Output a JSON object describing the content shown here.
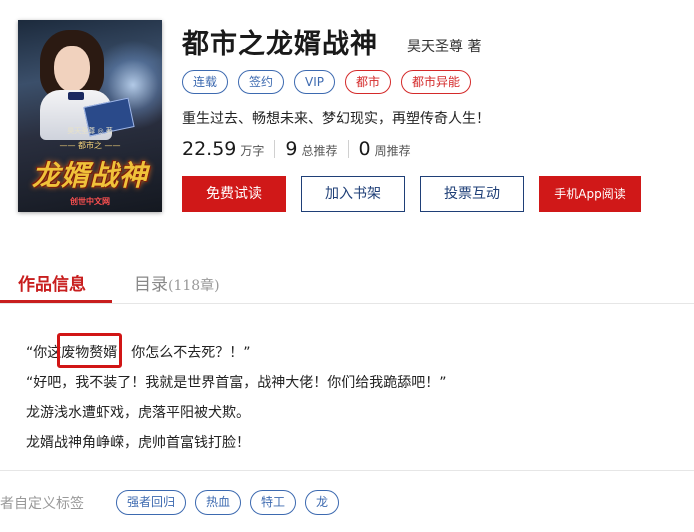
{
  "cover": {
    "author_line": "昊天圣尊 ◎ 著",
    "sub_title": "—— 都市之 ——",
    "big_title": "龙婿战神",
    "publisher": "创世中文网"
  },
  "book": {
    "title": "都市之龙婿战神",
    "author": "昊天圣尊 著",
    "tags": [
      {
        "label": "连载",
        "color": "#3d6ab0"
      },
      {
        "label": "签约",
        "color": "#3d6ab0"
      },
      {
        "label": "VIP",
        "color": "#3d6ab0"
      },
      {
        "label": "都市",
        "color": "#d42a2a"
      },
      {
        "label": "都市异能",
        "color": "#d42a2a"
      }
    ],
    "intro": "重生过去、畅想未来、梦幻现实，再塑传奇人生！",
    "stats": [
      {
        "num": "22.59",
        "unit": "万字"
      },
      {
        "num": "9",
        "unit": "总推荐"
      },
      {
        "num": "0",
        "unit": "周推荐"
      }
    ]
  },
  "actions": {
    "read": "免费试读",
    "shelf": "加入书架",
    "vote": "投票互动",
    "app": "手机App阅读"
  },
  "tabs": {
    "info": "作品信息",
    "catalog": "目录",
    "catalog_count": "(118章)"
  },
  "description": [
    "“你这废物赘婿，你怎么不去死？！”",
    "“好吧，我不装了！我就是世界首富，战神大佬！你们给我跪舔吧！”",
    "龙游浅水遭虾戏，虎落平阳被犬欺。",
    "龙婿战神角峥嵘，虎帅首富钱打脸！"
  ],
  "custom_tags": {
    "label": "作者自定义标签",
    "items": [
      "强者回归",
      "热血",
      "特工",
      "龙"
    ]
  },
  "colors": {
    "accent_red": "#d01818",
    "link_blue": "#3d6ab0",
    "navy": "#1f3f77"
  }
}
